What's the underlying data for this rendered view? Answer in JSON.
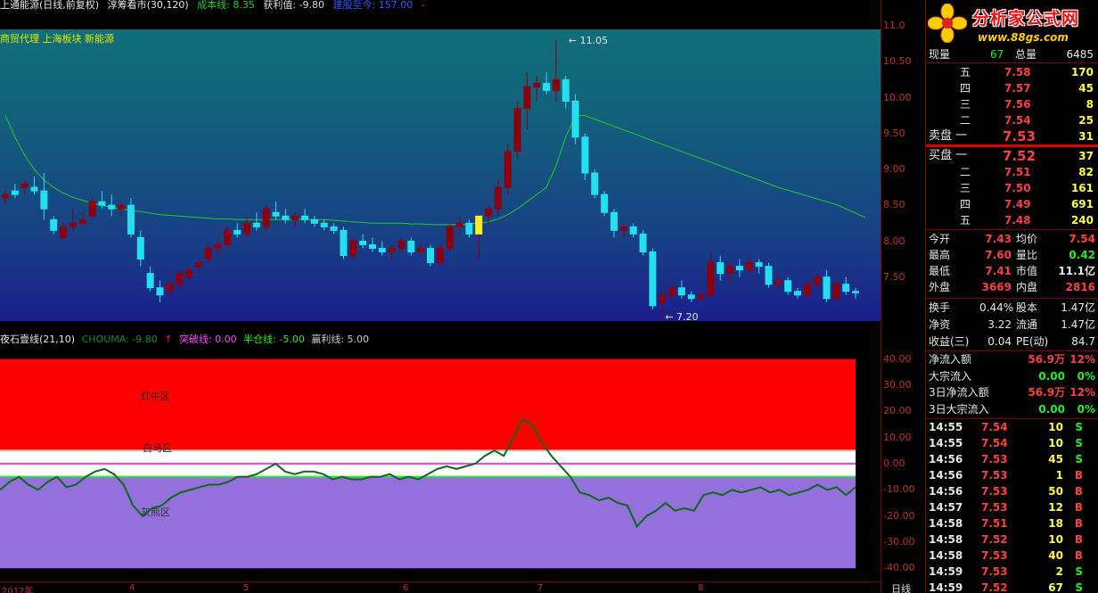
{
  "topbar": {
    "title": "上通能源(日线,前复权)",
    "indicator": "淳筹看市(30,120)",
    "cost_label": "成本线: 8.35",
    "profit_label": "获利值: -9.80",
    "extra_label": "建股至今: 157.00",
    "dash": "-"
  },
  "sector_line": "商贸代理 上海板块 新能源",
  "main_chart": {
    "high_label": "11.05",
    "low_label": "7.20",
    "y_ticks": [
      "11.0",
      "10.50",
      "10.00",
      "9.50",
      "9.00",
      "8.50",
      "8.00",
      "7.50"
    ]
  },
  "indicator_bar": {
    "title": "夜石壹线(21,10)",
    "chouma": "CHOUMA: -9.80",
    "arrow": "↑",
    "break_line": "突破线: 0.00",
    "half_line": "半仓线: -5.00",
    "profit_line": "赢利线: 5.00"
  },
  "sub_chart": {
    "zone_red": "红牛区",
    "zone_white": "白马区",
    "zone_grey": "灰熊区",
    "y_ticks": [
      "40.00",
      "30.00",
      "20.00",
      "10.00",
      "0.00",
      "-10.00",
      "-20.00",
      "-30.00",
      "-40.00"
    ]
  },
  "date_axis": {
    "ticks": [
      "2012年",
      "4",
      "5",
      "6",
      "7",
      "8"
    ],
    "period": "日线"
  },
  "right_panel": {
    "brand": "分析家公式网",
    "url": "www.88gs.com",
    "current_label": "现量",
    "current_val": "67",
    "total_label": "总量",
    "total_val": "6485",
    "asks": [
      {
        "label": "五",
        "price": "7.58",
        "vol": "170"
      },
      {
        "label": "四",
        "price": "7.57",
        "vol": "45"
      },
      {
        "label": "三",
        "price": "7.56",
        "vol": "8"
      },
      {
        "label": "二",
        "price": "7.54",
        "vol": "25"
      },
      {
        "label": "卖盘 一",
        "price": "7.53",
        "vol": "31"
      }
    ],
    "bids": [
      {
        "label": "买盘 一",
        "price": "7.52",
        "vol": "37"
      },
      {
        "label": "二",
        "price": "7.51",
        "vol": "82"
      },
      {
        "label": "三",
        "price": "7.50",
        "vol": "161"
      },
      {
        "label": "四",
        "price": "7.49",
        "vol": "691"
      },
      {
        "label": "五",
        "price": "7.48",
        "vol": "240"
      }
    ],
    "stats": [
      {
        "l1": "今开",
        "v1": "7.43",
        "l2": "均价",
        "v2": "7.54"
      },
      {
        "l1": "最高",
        "v1": "7.60",
        "l2": "量比",
        "v2": "0.42"
      },
      {
        "l1": "最低",
        "v1": "7.41",
        "l2": "市值",
        "v2": "11.1亿"
      },
      {
        "l1": "外盘",
        "v1": "3669",
        "l2": "内盘",
        "v2": "2816"
      }
    ],
    "stats2": [
      {
        "l1": "换手",
        "v1": "0.44%",
        "l2": "股本",
        "v2": "1.47亿"
      },
      {
        "l1": "净资",
        "v1": "3.22",
        "l2": "流通",
        "v2": "1.47亿"
      },
      {
        "l1": "收益(三)",
        "v1": "0.04",
        "l2": "PE(动)",
        "v2": "84.7"
      }
    ],
    "flows": [
      {
        "label": "净流入额",
        "val": "56.9万",
        "pct": "12%"
      },
      {
        "label": "大宗流入",
        "val": "0.00",
        "pct": "0%"
      },
      {
        "label": "3日净流入额",
        "val": "56.9万",
        "pct": "12%"
      },
      {
        "label": "3日大宗流入",
        "val": "0.00",
        "pct": "0%"
      }
    ],
    "ticks": [
      {
        "time": "14:55",
        "price": "7.54",
        "vol": "10",
        "side": "S"
      },
      {
        "time": "14:55",
        "price": "7.54",
        "vol": "10",
        "side": "S"
      },
      {
        "time": "14:56",
        "price": "7.53",
        "vol": "45",
        "side": "S"
      },
      {
        "time": "14:56",
        "price": "7.53",
        "vol": "1",
        "side": "B"
      },
      {
        "time": "14:56",
        "price": "7.53",
        "vol": "50",
        "side": "B"
      },
      {
        "time": "14:57",
        "price": "7.53",
        "vol": "12",
        "side": "B"
      },
      {
        "time": "14:58",
        "price": "7.51",
        "vol": "18",
        "side": "B"
      },
      {
        "time": "14:58",
        "price": "7.52",
        "vol": "10",
        "side": "B"
      },
      {
        "time": "14:58",
        "price": "7.53",
        "vol": "40",
        "side": "B"
      },
      {
        "time": "14:59",
        "price": "7.53",
        "vol": "2",
        "side": "S"
      },
      {
        "time": "14:59",
        "price": "7.52",
        "vol": "67",
        "side": "S"
      }
    ]
  },
  "chart_data": [
    {
      "type": "candlestick",
      "title": "",
      "ylim": [
        7.1,
        11.2
      ],
      "annotations": [
        "11.05",
        "7.20"
      ],
      "candles": [
        [
          8.85,
          8.95,
          8.75,
          8.9
        ],
        [
          8.95,
          9.05,
          8.85,
          8.9
        ],
        [
          9.0,
          9.1,
          8.9,
          9.05
        ],
        [
          9.0,
          9.15,
          8.9,
          8.95
        ],
        [
          8.95,
          9.2,
          8.55,
          8.7
        ],
        [
          8.55,
          8.6,
          8.35,
          8.4
        ],
        [
          8.3,
          8.5,
          8.25,
          8.45
        ],
        [
          8.45,
          8.7,
          8.4,
          8.5
        ],
        [
          8.5,
          8.65,
          8.45,
          8.55
        ],
        [
          8.6,
          8.85,
          8.55,
          8.8
        ],
        [
          8.8,
          8.95,
          8.7,
          8.75
        ],
        [
          8.75,
          8.9,
          8.6,
          8.7
        ],
        [
          8.7,
          8.8,
          8.6,
          8.75
        ],
        [
          8.75,
          8.85,
          8.3,
          8.35
        ],
        [
          8.3,
          8.4,
          7.9,
          8.0
        ],
        [
          7.8,
          7.9,
          7.55,
          7.6
        ],
        [
          7.6,
          7.7,
          7.4,
          7.5
        ],
        [
          7.55,
          7.7,
          7.5,
          7.65
        ],
        [
          7.65,
          7.85,
          7.6,
          7.8
        ],
        [
          7.75,
          7.9,
          7.7,
          7.85
        ],
        [
          7.9,
          8.0,
          7.8,
          7.95
        ],
        [
          8.0,
          8.2,
          7.95,
          8.15
        ],
        [
          8.15,
          8.3,
          8.05,
          8.2
        ],
        [
          8.2,
          8.45,
          8.15,
          8.4
        ],
        [
          8.4,
          8.5,
          8.3,
          8.35
        ],
        [
          8.35,
          8.6,
          8.3,
          8.5
        ],
        [
          8.5,
          8.65,
          8.4,
          8.45
        ],
        [
          8.45,
          8.75,
          8.4,
          8.7
        ],
        [
          8.65,
          8.8,
          8.55,
          8.6
        ],
        [
          8.6,
          8.7,
          8.5,
          8.55
        ],
        [
          8.55,
          8.65,
          8.45,
          8.6
        ],
        [
          8.6,
          8.7,
          8.5,
          8.55
        ],
        [
          8.55,
          8.6,
          8.45,
          8.5
        ],
        [
          8.5,
          8.55,
          8.4,
          8.45
        ],
        [
          8.45,
          8.5,
          8.35,
          8.4
        ],
        [
          8.4,
          8.45,
          8.0,
          8.05
        ],
        [
          8.05,
          8.3,
          8.0,
          8.25
        ],
        [
          8.25,
          8.35,
          8.15,
          8.2
        ],
        [
          8.2,
          8.3,
          8.1,
          8.15
        ],
        [
          8.15,
          8.25,
          8.05,
          8.1
        ],
        [
          8.1,
          8.2,
          8.0,
          8.15
        ],
        [
          8.15,
          8.3,
          8.1,
          8.25
        ],
        [
          8.25,
          8.3,
          8.05,
          8.1
        ],
        [
          8.1,
          8.2,
          8.05,
          8.15
        ],
        [
          8.15,
          8.2,
          7.9,
          7.95
        ],
        [
          7.95,
          8.2,
          7.9,
          8.15
        ],
        [
          8.15,
          8.5,
          8.1,
          8.45
        ],
        [
          8.45,
          8.6,
          8.35,
          8.5
        ],
        [
          8.5,
          8.55,
          8.3,
          8.35
        ],
        [
          8.35,
          8.6,
          8.0,
          8.6
        ],
        [
          8.6,
          8.75,
          8.5,
          8.7
        ],
        [
          8.7,
          9.1,
          8.6,
          9.0
        ],
        [
          9.0,
          9.6,
          8.9,
          9.5
        ],
        [
          9.5,
          10.2,
          9.4,
          10.1
        ],
        [
          10.1,
          10.6,
          9.8,
          10.4
        ],
        [
          10.4,
          10.55,
          10.2,
          10.45
        ],
        [
          10.45,
          10.6,
          10.3,
          10.35
        ],
        [
          10.35,
          11.05,
          10.2,
          10.5
        ],
        [
          10.5,
          10.55,
          10.1,
          10.2
        ],
        [
          10.2,
          10.3,
          9.6,
          9.7
        ],
        [
          9.7,
          9.75,
          9.1,
          9.2
        ],
        [
          9.2,
          9.25,
          8.85,
          8.9
        ],
        [
          8.9,
          8.95,
          8.6,
          8.65
        ],
        [
          8.65,
          8.7,
          8.3,
          8.4
        ],
        [
          8.4,
          8.5,
          8.3,
          8.45
        ],
        [
          8.45,
          8.5,
          8.3,
          8.35
        ],
        [
          8.35,
          8.4,
          8.05,
          8.1
        ],
        [
          8.1,
          8.15,
          7.3,
          7.35
        ],
        [
          7.4,
          7.55,
          7.2,
          7.5
        ],
        [
          7.5,
          7.65,
          7.45,
          7.6
        ],
        [
          7.6,
          7.7,
          7.45,
          7.5
        ],
        [
          7.5,
          7.55,
          7.4,
          7.45
        ],
        [
          7.45,
          7.55,
          7.4,
          7.5
        ],
        [
          7.5,
          8.1,
          7.45,
          7.95
        ],
        [
          7.95,
          8.05,
          7.7,
          7.8
        ],
        [
          7.8,
          7.95,
          7.65,
          7.9
        ],
        [
          7.9,
          8.0,
          7.75,
          7.85
        ],
        [
          7.85,
          8.05,
          7.8,
          7.95
        ],
        [
          7.95,
          8.0,
          7.8,
          7.9
        ],
        [
          7.9,
          7.95,
          7.6,
          7.65
        ],
        [
          7.65,
          7.8,
          7.55,
          7.7
        ],
        [
          7.7,
          7.75,
          7.5,
          7.55
        ],
        [
          7.55,
          7.6,
          7.45,
          7.5
        ],
        [
          7.5,
          7.7,
          7.45,
          7.65
        ],
        [
          7.65,
          7.8,
          7.6,
          7.75
        ],
        [
          7.75,
          7.85,
          7.4,
          7.45
        ],
        [
          7.45,
          7.7,
          7.4,
          7.65
        ],
        [
          7.65,
          7.75,
          7.5,
          7.55
        ],
        [
          7.55,
          7.6,
          7.45,
          7.53
        ]
      ],
      "series": [
        {
          "name": "",
          "color": "#22cc22",
          "values": [
            10.0,
            9.7,
            9.45,
            9.25,
            9.1,
            9.0,
            8.92,
            8.86,
            8.82,
            8.78,
            8.75,
            8.72,
            8.7,
            8.68,
            8.66,
            8.64,
            8.62,
            8.61,
            8.6,
            8.59,
            8.58,
            8.57,
            8.56,
            8.56,
            8.55,
            8.55,
            8.55,
            8.55,
            8.55,
            8.55,
            8.55,
            8.55,
            8.55,
            8.55,
            8.54,
            8.53,
            8.52,
            8.51,
            8.5,
            8.5,
            8.5,
            8.5,
            8.49,
            8.49,
            8.48,
            8.48,
            8.48,
            8.48,
            8.49,
            8.5,
            8.52,
            8.56,
            8.62,
            8.7,
            8.8,
            8.9,
            9.0,
            9.3,
            9.7,
            10.0,
            10.0,
            9.95,
            9.9,
            9.85,
            9.8,
            9.75,
            9.7,
            9.65,
            9.6,
            9.55,
            9.5,
            9.45,
            9.4,
            9.35,
            9.3,
            9.25,
            9.2,
            9.15,
            9.1,
            9.05,
            9.0,
            8.96,
            8.92,
            8.88,
            8.84,
            8.8,
            8.76,
            8.7,
            8.64,
            8.58
          ]
        }
      ]
    },
    {
      "type": "line",
      "title": "",
      "ylim": [
        -45,
        45
      ],
      "series": [
        {
          "name": "",
          "color": "#0a7a2a",
          "values": [
            -10,
            -7,
            -5,
            -8,
            -10,
            -7,
            -5,
            -9,
            -8,
            -5,
            -3,
            -2,
            -4,
            -8,
            -16,
            -20,
            -17,
            -16,
            -13,
            -11,
            -10,
            -9,
            -8,
            -8,
            -7,
            -5,
            -5,
            -4,
            -2,
            0,
            -3,
            -4,
            -3,
            -3,
            -4,
            -6,
            -5,
            -6,
            -6,
            -5,
            -5,
            -4,
            -6,
            -5,
            -6,
            -4,
            -2,
            -1,
            -2,
            -1,
            0,
            3,
            5,
            3,
            10,
            17,
            15,
            8,
            3,
            -1,
            -5,
            -11,
            -12,
            -14,
            -13,
            -15,
            -16,
            -24,
            -20,
            -18,
            -15,
            -18,
            -17,
            -18,
            -12,
            -11,
            -12,
            -10,
            -11,
            -10,
            -9,
            -11,
            -10,
            -12,
            -11,
            -10,
            -8,
            -10,
            -9,
            -12,
            -9
          ]
        }
      ],
      "levels": [
        {
          "name": "突破线",
          "value": 0
        },
        {
          "name": "半仓线",
          "value": -5
        },
        {
          "name": "赢利线",
          "value": 5
        }
      ]
    }
  ]
}
